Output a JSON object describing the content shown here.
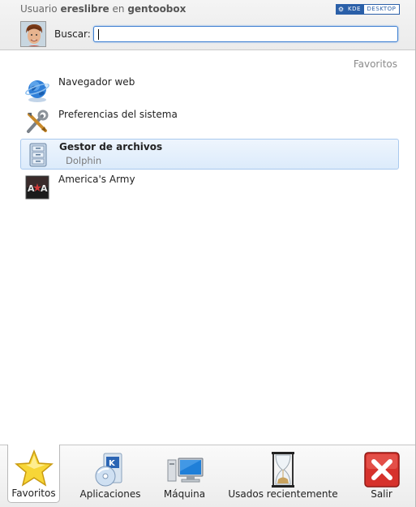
{
  "header": {
    "user_prefix": "Usuario",
    "username": "ereslibre",
    "host_prefix": "en",
    "hostname": "gentoobox",
    "logo_kde": "KDE",
    "logo_desktop": "DESKTOP",
    "search_label": "Buscar:",
    "search_value": ""
  },
  "favorites": {
    "section_title": "Favoritos",
    "items": [
      {
        "label": "Navegador web",
        "sublabel": "",
        "icon": "globe-icon"
      },
      {
        "label": "Preferencias del sistema",
        "sublabel": "",
        "icon": "tools-icon"
      },
      {
        "label": "Gestor de archivos",
        "sublabel": "Dolphin",
        "icon": "file-cabinet-icon"
      },
      {
        "label": "America's Army",
        "sublabel": "",
        "icon": "americas-army-icon"
      }
    ]
  },
  "tabs": [
    {
      "label": "Favoritos",
      "icon": "star-icon",
      "active": true
    },
    {
      "label": "Aplicaciones",
      "icon": "applications-icon",
      "active": false
    },
    {
      "label": "Máquina",
      "icon": "computer-icon",
      "active": false
    },
    {
      "label": "Usados recientemente",
      "icon": "hourglass-icon",
      "active": false
    },
    {
      "label": "Salir",
      "icon": "exit-icon",
      "active": false
    }
  ],
  "colors": {
    "accent": "#3d7fd1",
    "selected_bg": "#dcebfb",
    "muted_text": "#8a8a8a"
  }
}
